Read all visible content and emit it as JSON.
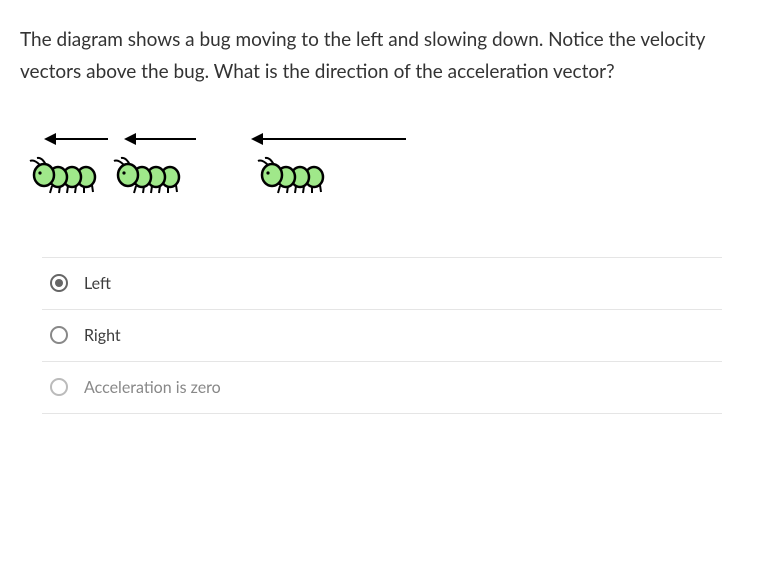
{
  "question_text": "The diagram shows a bug moving to the left and slowing down. Notice the velocity vectors above the bug.  What is the direction of the acceleration vector?",
  "diagram": {
    "description": "three bugs with left-pointing velocity arrows of decreasing length, rightmost arrow longest"
  },
  "options": [
    {
      "label": "Left",
      "selected": true,
      "muted": false
    },
    {
      "label": "Right",
      "selected": false,
      "muted": false
    },
    {
      "label": "Acceleration is zero",
      "selected": false,
      "muted": true
    }
  ]
}
